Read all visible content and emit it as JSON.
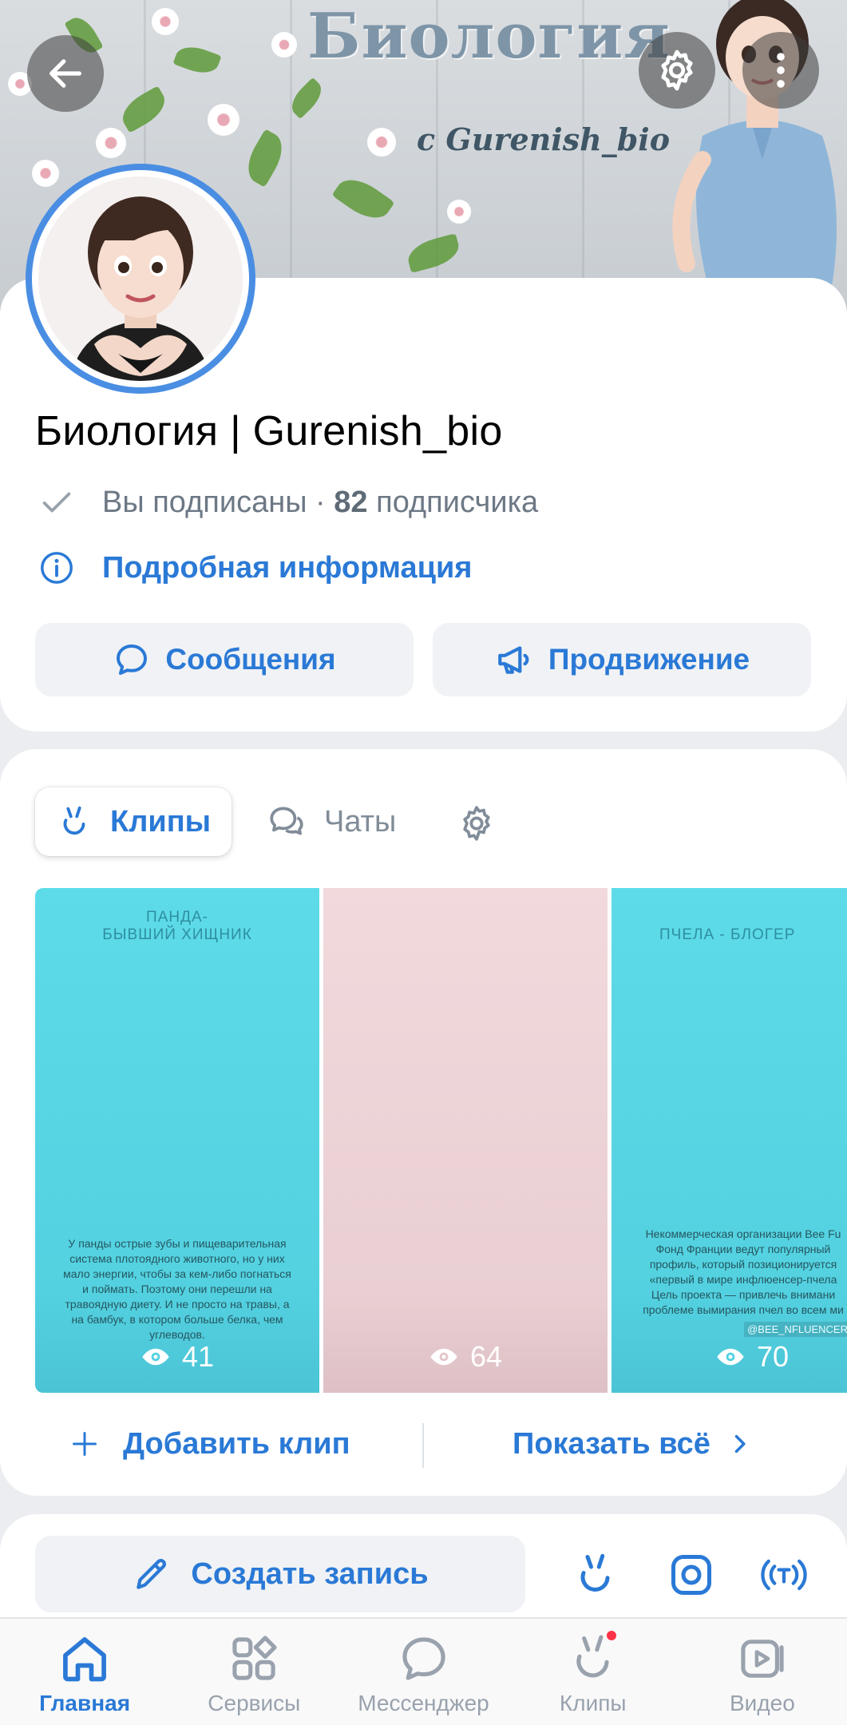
{
  "cover": {
    "title": "Биология",
    "subtitle": "с Gurenish_bio"
  },
  "profile": {
    "name": "Биология | Gurenish_bio",
    "subscribed_label": "Вы подписаны ·",
    "subscribers_count": "82",
    "subscribers_label": "подписчика",
    "info_link": "Подробная информация",
    "messages_button": "Сообщения",
    "promotion_button": "Продвижение"
  },
  "clips_section": {
    "tabs": [
      {
        "label": "Клипы",
        "active": true
      },
      {
        "label": "Чаты",
        "active": false
      }
    ],
    "clips": [
      {
        "title_line1": "ПАНДА-",
        "title_line2": "БЫВШИЙ ХИЩНИК",
        "text": "У панды острые зубы и пищеварительная система плотоядного животного, но у них мало энергии, чтобы за кем-либо погнаться и поймать. Поэтому они перешли на травоядную диету. И не просто на травы, а на бамбук, в котором больше белка, чем углеводов.",
        "views": "41"
      },
      {
        "views": "64"
      },
      {
        "title_line1": "ПЧЕЛА - БЛОГЕР",
        "text": "Некоммерческая организации Bee Fu Фонд Франции ведут популярный профиль, который позиционируется «первый в мире инфлюенсер-пчела Цель проекта — привлечь внимани проблеме вымирания пчел во всем ми",
        "watermark": "@BEE_NFLUENCER",
        "views": "70"
      }
    ],
    "add_clip": "Добавить клип",
    "show_all": "Показать всё"
  },
  "post": {
    "create_post": "Создать запись"
  },
  "bottom_nav": {
    "items": [
      {
        "label": "Главная",
        "icon": "home-icon",
        "active": true
      },
      {
        "label": "Сервисы",
        "icon": "services-icon",
        "active": false
      },
      {
        "label": "Мессенджер",
        "icon": "messenger-icon",
        "active": false
      },
      {
        "label": "Клипы",
        "icon": "clips-icon",
        "active": false
      },
      {
        "label": "Видео",
        "icon": "video-icon",
        "active": false
      }
    ]
  },
  "colors": {
    "accent": "#2a79d6",
    "muted": "#818c99",
    "badge": "#ff3347"
  }
}
